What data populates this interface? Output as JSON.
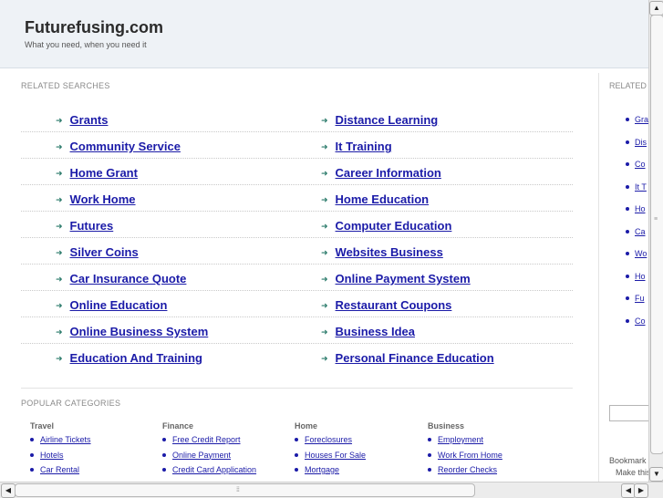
{
  "header": {
    "title": "Futurefusing.com",
    "tagline": "What you need, when you need it"
  },
  "related_searches": {
    "label": "RELATED SEARCHES",
    "rows": [
      {
        "left": "Grants",
        "right": "Distance Learning"
      },
      {
        "left": "Community Service",
        "right": "It Training"
      },
      {
        "left": "Home Grant",
        "right": "Career Information"
      },
      {
        "left": "Work Home",
        "right": "Home Education"
      },
      {
        "left": "Futures",
        "right": "Computer Education"
      },
      {
        "left": "Silver Coins",
        "right": "Websites Business"
      },
      {
        "left": "Car Insurance Quote",
        "right": "Online Payment System"
      },
      {
        "left": "Online Education",
        "right": "Restaurant Coupons"
      },
      {
        "left": "Online Business System",
        "right": "Business Idea"
      },
      {
        "left": "Education And Training",
        "right": "Personal Finance Education"
      }
    ]
  },
  "popular_categories": {
    "label": "POPULAR CATEGORIES",
    "columns": [
      {
        "heading": "Travel",
        "links": [
          "Airline Tickets",
          "Hotels",
          "Car Rental"
        ]
      },
      {
        "heading": "Finance",
        "links": [
          "Free Credit Report",
          "Online Payment",
          "Credit Card Application"
        ]
      },
      {
        "heading": "Home",
        "links": [
          "Foreclosures",
          "Houses For Sale",
          "Mortgage"
        ]
      },
      {
        "heading": "Business",
        "links": [
          "Employment",
          "Work From Home",
          "Reorder Checks"
        ]
      }
    ]
  },
  "sidebar": {
    "label": "RELATED",
    "items": [
      "Gra",
      "Dis",
      "Co",
      "It T",
      "Ho",
      "Ca",
      "Wo",
      "Ho",
      "Fu",
      "Co"
    ],
    "bookmark_text": "Bookmark",
    "make_this_text": "Make this"
  },
  "icons": {
    "arrow": "arrow-right-icon",
    "bullet": "bullet-icon"
  },
  "colors": {
    "link": "#1b1ba8",
    "arrow": "#2a7a6a",
    "header_bg": "#eef2f6"
  }
}
